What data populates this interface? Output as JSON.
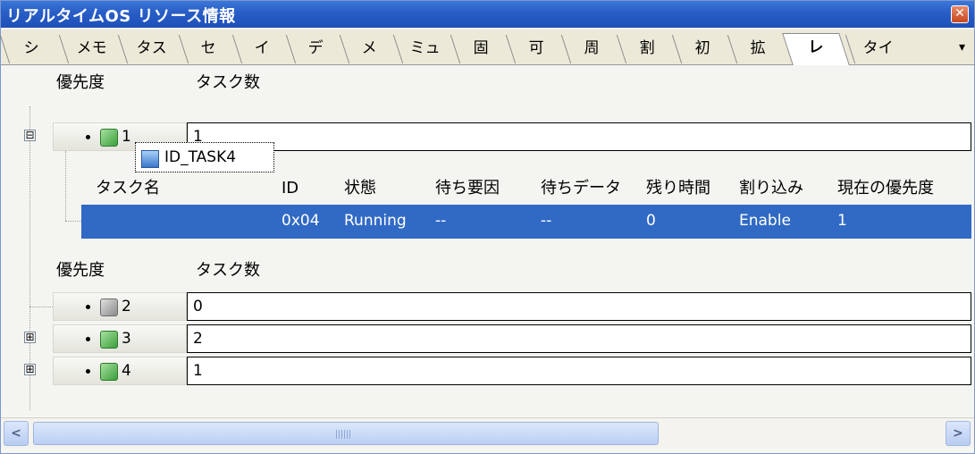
{
  "window": {
    "title": "リアルタイムOS リソース情報",
    "close_glyph": "✕"
  },
  "tabs": [
    {
      "label": "シ"
    },
    {
      "label": "メモ"
    },
    {
      "label": "タス"
    },
    {
      "label": "セ"
    },
    {
      "label": "イ"
    },
    {
      "label": "デ"
    },
    {
      "label": "メ"
    },
    {
      "label": "ミュ"
    },
    {
      "label": "固"
    },
    {
      "label": "可"
    },
    {
      "label": "周"
    },
    {
      "label": "割"
    },
    {
      "label": "初"
    },
    {
      "label": "拡"
    },
    {
      "label": "レ",
      "active": true
    },
    {
      "label": "タイ"
    }
  ],
  "tab_more_glyph": "▾",
  "top_group": {
    "header": {
      "priority": "優先度",
      "task_count": "タスク数"
    },
    "row": {
      "priority": "1",
      "task_count": "1",
      "expander": "⊟"
    }
  },
  "task_table": {
    "columns": [
      "タスク名",
      "ID",
      "状態",
      "待ち要因",
      "待ちデータ",
      "残り時間",
      "割り込み",
      "現在の優先度"
    ],
    "row": {
      "name": "ID_TASK4",
      "id": "0x04",
      "state": "Running",
      "wait_factor": "--",
      "wait_data": "--",
      "remaining": "0",
      "interrupt": "Enable",
      "current_priority": "1"
    }
  },
  "bottom_group": {
    "header": {
      "priority": "優先度",
      "task_count": "タスク数"
    },
    "rows": [
      {
        "priority": "2",
        "task_count": "0",
        "expander": "",
        "icon": "gray"
      },
      {
        "priority": "3",
        "task_count": "2",
        "expander": "⊞",
        "icon": "green"
      },
      {
        "priority": "4",
        "task_count": "1",
        "expander": "⊞",
        "icon": "green"
      }
    ]
  },
  "scrollbar": {
    "left_glyph": "<",
    "right_glyph": ">"
  },
  "colors": {
    "titlebar": "#2a5fc8",
    "selection": "#316ac5"
  }
}
